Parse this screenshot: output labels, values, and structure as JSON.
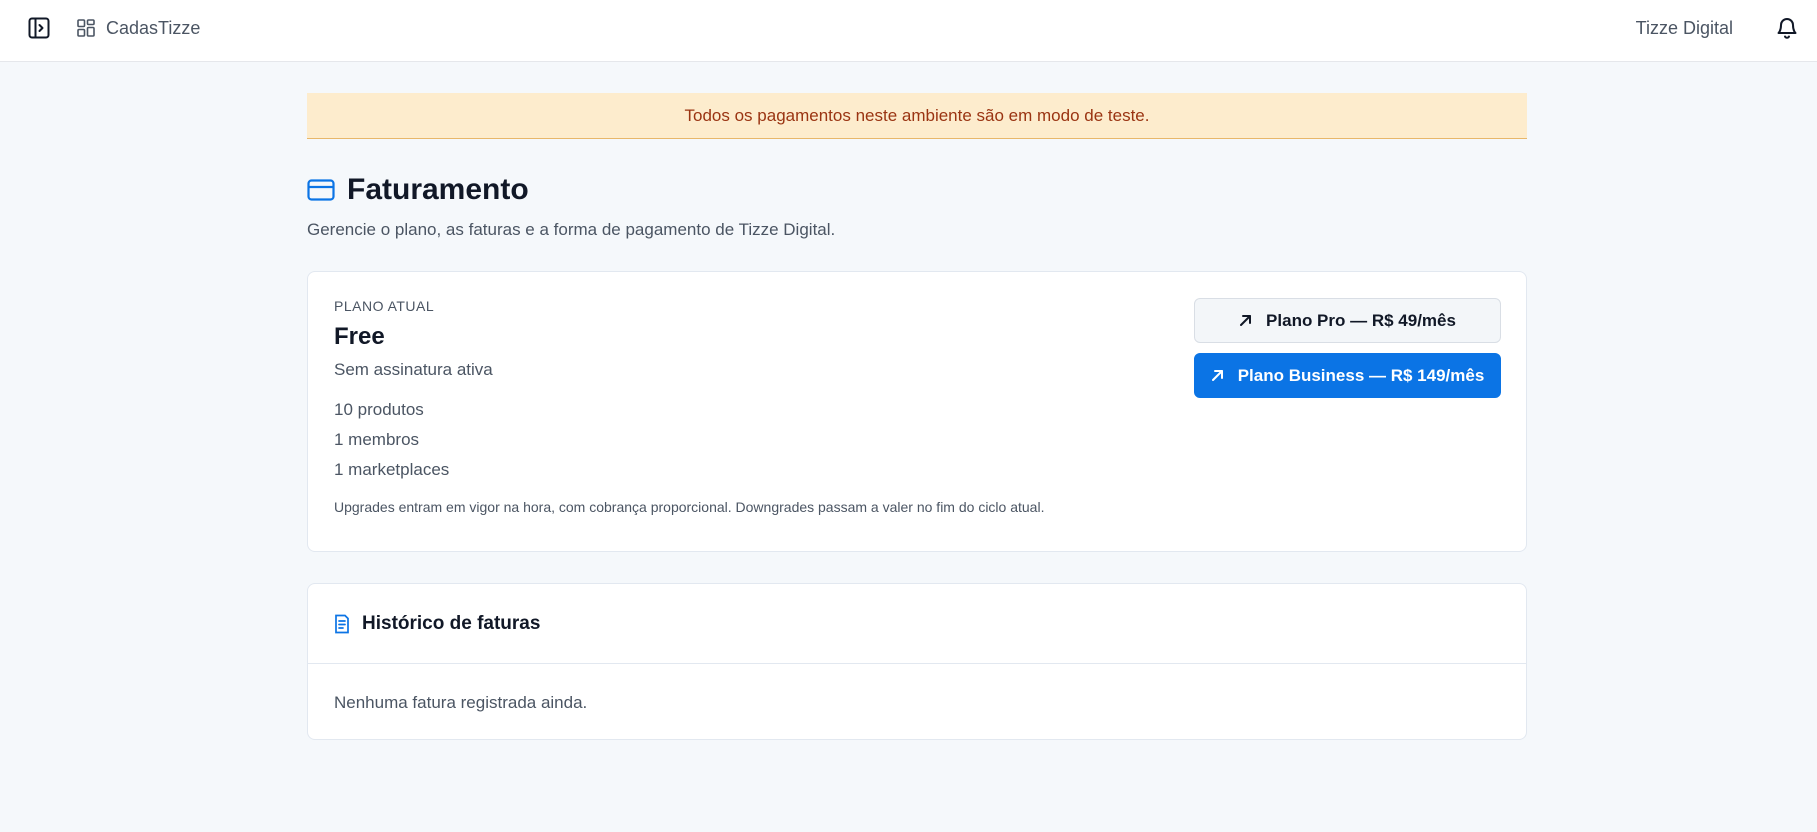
{
  "header": {
    "app_name": "CadasTizze",
    "organization": "Tizze Digital"
  },
  "banner": {
    "text": "Todos os pagamentos neste ambiente são em modo de teste."
  },
  "page": {
    "title": "Faturamento",
    "subtitle": "Gerencie o plano, as faturas e a forma de pagamento de Tizze Digital."
  },
  "plan": {
    "eyebrow": "PLANO ATUAL",
    "name": "Free",
    "status": "Sem assinatura ativa",
    "features": [
      "10 produtos",
      "1 membros",
      "1 marketplaces"
    ],
    "note": "Upgrades entram em vigor na hora, com cobrança proporcional. Downgrades passam a valer no fim do ciclo atual.",
    "actions": {
      "pro_label": "Plano Pro — R$ 49/mês",
      "business_label": "Plano Business — R$ 149/mês"
    }
  },
  "invoices": {
    "title": "Histórico de faturas",
    "empty_text": "Nenhuma fatura registrada ainda."
  },
  "icons": {
    "sidebar_toggle": "sidebar-toggle-icon",
    "brand": "grid-icon",
    "bell": "bell-icon",
    "billing": "credit-card-icon",
    "upgrade": "arrow-up-right-icon",
    "invoices": "receipt-icon"
  },
  "colors": {
    "accent": "#0b74e5",
    "banner_bg": "#fdeccd",
    "banner_text": "#9a3412",
    "page_bg": "#f5f8fb"
  }
}
